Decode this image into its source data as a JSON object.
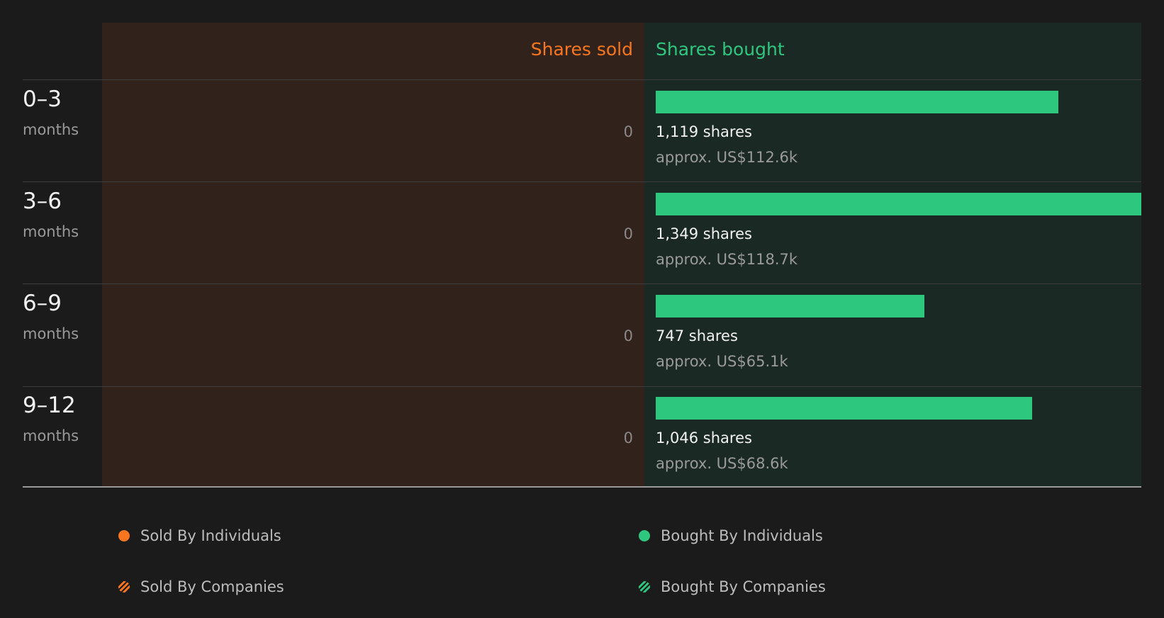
{
  "colors": {
    "sold": "#f9761e",
    "bought": "#2ec77e"
  },
  "chart_data": {
    "type": "bar",
    "headers": {
      "sold": "Shares sold",
      "bought": "Shares bought"
    },
    "rows": [
      {
        "period": "0–3",
        "unit": "months",
        "sold": "0",
        "bought": 1119,
        "bought_label": "1,119 shares",
        "approx": "approx. US$112.6k"
      },
      {
        "period": "3–6",
        "unit": "months",
        "sold": "0",
        "bought": 1349,
        "bought_label": "1,349 shares",
        "approx": "approx. US$118.7k"
      },
      {
        "period": "6–9",
        "unit": "months",
        "sold": "0",
        "bought": 747,
        "bought_label": "747 shares",
        "approx": "approx. US$65.1k"
      },
      {
        "period": "9–12",
        "unit": "months",
        "sold": "0",
        "bought": 1046,
        "bought_label": "1,046 shares",
        "approx": "approx. US$68.6k"
      }
    ],
    "bought_max": 1349,
    "legend": [
      {
        "label": "Sold By Individuals",
        "kind": "sold",
        "style": "solid"
      },
      {
        "label": "Bought By Individuals",
        "kind": "bought",
        "style": "solid"
      },
      {
        "label": "Sold By Companies",
        "kind": "sold",
        "style": "striped"
      },
      {
        "label": "Bought By Companies",
        "kind": "bought",
        "style": "striped"
      }
    ]
  }
}
